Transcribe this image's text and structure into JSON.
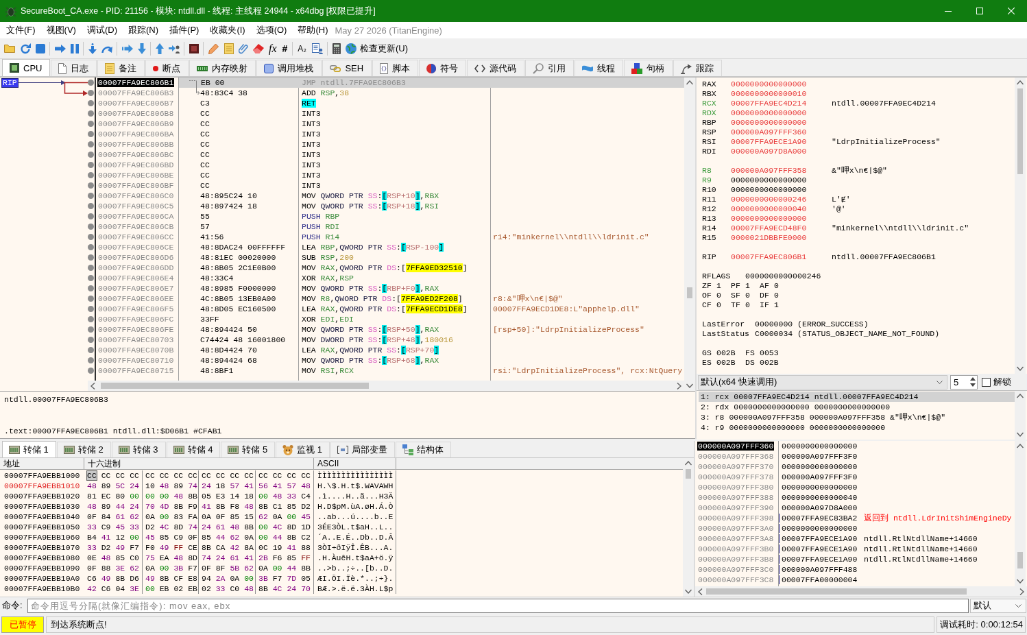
{
  "window": {
    "title": "SecureBoot_CA.exe - PID: 21156 - 模块: ntdll.dll - 线程: 主线程 24944 - x64dbg [权限已提升]"
  },
  "menu": {
    "items": [
      "文件(F)",
      "视图(V)",
      "调试(D)",
      "跟踪(N)",
      "插件(P)",
      "收藏夹(I)",
      "选项(O)",
      "帮助(H)"
    ],
    "build": "May 27 2026 (TitanEngine)"
  },
  "toolbar": {
    "glyphs": [
      "fx",
      "#",
      "A₂"
    ],
    "update_button": "检查更新(U)"
  },
  "tabs": [
    {
      "label": "CPU",
      "selected": true
    },
    {
      "label": "日志",
      "selected": false
    },
    {
      "label": "备注",
      "selected": false
    },
    {
      "label": "断点",
      "selected": false
    },
    {
      "label": "内存映射",
      "selected": false
    },
    {
      "label": "调用堆栈",
      "selected": false
    },
    {
      "label": "SEH",
      "selected": false
    },
    {
      "label": "脚本",
      "selected": false
    },
    {
      "label": "符号",
      "selected": false
    },
    {
      "label": "源代码",
      "selected": false
    },
    {
      "label": "引用",
      "selected": false
    },
    {
      "label": "线程",
      "selected": false
    },
    {
      "label": "句柄",
      "selected": false
    },
    {
      "label": "跟踪",
      "selected": false
    }
  ],
  "disassembly": {
    "rip_label": "RIP",
    "rows": [
      {
        "address": "00007FFA9EC806B1",
        "bytes": "EB 00",
        "kind": "jump_source",
        "selected": true,
        "instruction": [
          {
            "text": "JMP ntdll.7FFA9EC806B3",
            "kind": "dimmed"
          }
        ]
      },
      {
        "address": "00007FFA9EC806B3",
        "bytes": "48:83C4 38",
        "kind": "jump_target",
        "selected": false,
        "instruction": [
          {
            "text": "ADD ",
            "kind": "mnemonic"
          },
          {
            "text": "RSP",
            "kind": "register"
          },
          {
            "text": ",",
            "kind": "plain"
          },
          {
            "text": "38",
            "kind": "number"
          }
        ]
      },
      {
        "address": "00007FFA9EC806B7",
        "bytes": "C3",
        "kind": "code",
        "selected": false,
        "instruction": [
          {
            "text": "RET",
            "kind": "return"
          }
        ]
      },
      {
        "address": "00007FFA9EC806B8",
        "bytes": "CC",
        "kind": "code",
        "selected": false,
        "instruction": [
          {
            "text": "INT3",
            "kind": "mnemonic"
          }
        ]
      },
      {
        "address": "00007FFA9EC806B9",
        "bytes": "CC",
        "kind": "code",
        "selected": false,
        "instruction": [
          {
            "text": "INT3",
            "kind": "mnemonic"
          }
        ]
      },
      {
        "address": "00007FFA9EC806BA",
        "bytes": "CC",
        "kind": "code",
        "selected": false,
        "instruction": [
          {
            "text": "INT3",
            "kind": "mnemonic"
          }
        ]
      },
      {
        "address": "00007FFA9EC806BB",
        "bytes": "CC",
        "kind": "code",
        "selected": false,
        "instruction": [
          {
            "text": "INT3",
            "kind": "mnemonic"
          }
        ]
      },
      {
        "address": "00007FFA9EC806BC",
        "bytes": "CC",
        "kind": "code",
        "selected": false,
        "instruction": [
          {
            "text": "INT3",
            "kind": "mnemonic"
          }
        ]
      },
      {
        "address": "00007FFA9EC806BD",
        "bytes": "CC",
        "kind": "code",
        "selected": false,
        "instruction": [
          {
            "text": "INT3",
            "kind": "mnemonic"
          }
        ]
      },
      {
        "address": "00007FFA9EC806BE",
        "bytes": "CC",
        "kind": "code",
        "selected": false,
        "instruction": [
          {
            "text": "INT3",
            "kind": "mnemonic"
          }
        ]
      },
      {
        "address": "00007FFA9EC806BF",
        "bytes": "CC",
        "kind": "code",
        "selected": false,
        "instruction": [
          {
            "text": "INT3",
            "kind": "mnemonic"
          }
        ]
      },
      {
        "address": "00007FFA9EC806C0",
        "bytes": "48:895C24 10",
        "kind": "code",
        "selected": false,
        "instruction": [
          {
            "text": "MOV ",
            "kind": "mnemonic"
          },
          {
            "text": "QWORD PTR ",
            "kind": "size"
          },
          {
            "text": "SS",
            "kind": "segment"
          },
          {
            "text": ":",
            "kind": "plain"
          },
          {
            "text": "[",
            "kind": "bracket"
          },
          {
            "text": "RSP+10",
            "kind": "memory"
          },
          {
            "text": "]",
            "kind": "bracket"
          },
          {
            "text": ",",
            "kind": "plain"
          },
          {
            "text": "RBX",
            "kind": "register"
          }
        ]
      },
      {
        "address": "00007FFA9EC806C5",
        "bytes": "48:897424 18",
        "kind": "code",
        "selected": false,
        "instruction": [
          {
            "text": "MOV ",
            "kind": "mnemonic"
          },
          {
            "text": "QWORD PTR ",
            "kind": "size"
          },
          {
            "text": "SS",
            "kind": "segment"
          },
          {
            "text": ":",
            "kind": "plain"
          },
          {
            "text": "[",
            "kind": "bracket"
          },
          {
            "text": "RSP+18",
            "kind": "memory"
          },
          {
            "text": "]",
            "kind": "bracket"
          },
          {
            "text": ",",
            "kind": "plain"
          },
          {
            "text": "RSI",
            "kind": "register"
          }
        ]
      },
      {
        "address": "00007FFA9EC806CA",
        "bytes": "55",
        "kind": "code",
        "selected": false,
        "instruction": [
          {
            "text": "PUSH ",
            "kind": "stack_op"
          },
          {
            "text": "RBP",
            "kind": "register"
          }
        ]
      },
      {
        "address": "00007FFA9EC806CB",
        "bytes": "57",
        "kind": "code",
        "selected": false,
        "instruction": [
          {
            "text": "PUSH ",
            "kind": "stack_op"
          },
          {
            "text": "RDI",
            "kind": "register"
          }
        ]
      },
      {
        "address": "00007FFA9EC806CC",
        "bytes": "41:56",
        "kind": "code",
        "selected": false,
        "instruction": [
          {
            "text": "PUSH ",
            "kind": "stack_op"
          },
          {
            "text": "R14",
            "kind": "register"
          }
        ],
        "comment": "r14:\"minkernel\\\\ntdll\\\\ldrinit.c\""
      },
      {
        "address": "00007FFA9EC806CE",
        "bytes": "48:8DAC24 00FFFFFF",
        "kind": "code",
        "selected": false,
        "instruction": [
          {
            "text": "LEA ",
            "kind": "mnemonic"
          },
          {
            "text": "RBP",
            "kind": "register"
          },
          {
            "text": ",",
            "kind": "plain"
          },
          {
            "text": "QWORD PTR ",
            "kind": "size"
          },
          {
            "text": "SS",
            "kind": "segment"
          },
          {
            "text": ":",
            "kind": "plain"
          },
          {
            "text": "[",
            "kind": "bracket"
          },
          {
            "text": "RSP-100",
            "kind": "memory"
          },
          {
            "text": "]",
            "kind": "bracket"
          }
        ]
      },
      {
        "address": "00007FFA9EC806D6",
        "bytes": "48:81EC 00020000",
        "kind": "code",
        "selected": false,
        "instruction": [
          {
            "text": "SUB ",
            "kind": "mnemonic"
          },
          {
            "text": "RSP",
            "kind": "register"
          },
          {
            "text": ",",
            "kind": "plain"
          },
          {
            "text": "200",
            "kind": "number"
          }
        ]
      },
      {
        "address": "00007FFA9EC806DD",
        "bytes": "48:8B05 2C1E0B00",
        "kind": "code",
        "selected": false,
        "instruction": [
          {
            "text": "MOV ",
            "kind": "mnemonic"
          },
          {
            "text": "RAX",
            "kind": "register"
          },
          {
            "text": ",",
            "kind": "plain"
          },
          {
            "text": "QWORD PTR ",
            "kind": "size"
          },
          {
            "text": "DS",
            "kind": "segment"
          },
          {
            "text": ":[",
            "kind": "plain"
          },
          {
            "text": "7FFA9ED32510",
            "kind": "address"
          },
          {
            "text": "]",
            "kind": "plain"
          }
        ]
      },
      {
        "address": "00007FFA9EC806E4",
        "bytes": "48:33C4",
        "kind": "code",
        "selected": false,
        "instruction": [
          {
            "text": "XOR ",
            "kind": "mnemonic"
          },
          {
            "text": "RAX",
            "kind": "register"
          },
          {
            "text": ",",
            "kind": "plain"
          },
          {
            "text": "RSP",
            "kind": "register"
          }
        ]
      },
      {
        "address": "00007FFA9EC806E7",
        "bytes": "48:8985 F0000000",
        "kind": "code",
        "selected": false,
        "instruction": [
          {
            "text": "MOV ",
            "kind": "mnemonic"
          },
          {
            "text": "QWORD PTR ",
            "kind": "size"
          },
          {
            "text": "SS",
            "kind": "segment"
          },
          {
            "text": ":",
            "kind": "plain"
          },
          {
            "text": "[",
            "kind": "bracket"
          },
          {
            "text": "RBP+F0",
            "kind": "memory"
          },
          {
            "text": "]",
            "kind": "bracket"
          },
          {
            "text": ",",
            "kind": "plain"
          },
          {
            "text": "RAX",
            "kind": "register"
          }
        ]
      },
      {
        "address": "00007FFA9EC806EE",
        "bytes": "4C:8B05 13EB0A00",
        "kind": "code",
        "selected": false,
        "instruction": [
          {
            "text": "MOV ",
            "kind": "mnemonic"
          },
          {
            "text": "R8",
            "kind": "register"
          },
          {
            "text": ",",
            "kind": "plain"
          },
          {
            "text": "QWORD PTR ",
            "kind": "size"
          },
          {
            "text": "DS",
            "kind": "segment"
          },
          {
            "text": ":[",
            "kind": "plain"
          },
          {
            "text": "7FFA9ED2F208",
            "kind": "address"
          },
          {
            "text": "]",
            "kind": "plain"
          }
        ],
        "comment": "r8:&\"呷x\\n€|$@\""
      },
      {
        "address": "00007FFA9EC806F5",
        "bytes": "48:8D05 EC160500",
        "kind": "code",
        "selected": false,
        "instruction": [
          {
            "text": "LEA ",
            "kind": "mnemonic"
          },
          {
            "text": "RAX",
            "kind": "register"
          },
          {
            "text": ",",
            "kind": "plain"
          },
          {
            "text": "QWORD PTR ",
            "kind": "size"
          },
          {
            "text": "DS",
            "kind": "segment"
          },
          {
            "text": ":[",
            "kind": "plain"
          },
          {
            "text": "7FFA9ECD1DE8",
            "kind": "address"
          },
          {
            "text": "]",
            "kind": "plain"
          }
        ],
        "comment": "00007FFA9ECD1DE8:L\"apphelp.dll\""
      },
      {
        "address": "00007FFA9EC806FC",
        "bytes": "33FF",
        "kind": "code",
        "selected": false,
        "instruction": [
          {
            "text": "XOR ",
            "kind": "mnemonic"
          },
          {
            "text": "EDI",
            "kind": "register"
          },
          {
            "text": ",",
            "kind": "plain"
          },
          {
            "text": "EDI",
            "kind": "register"
          }
        ]
      },
      {
        "address": "00007FFA9EC806FE",
        "bytes": "48:894424 50",
        "kind": "code",
        "selected": false,
        "instruction": [
          {
            "text": "MOV ",
            "kind": "mnemonic"
          },
          {
            "text": "QWORD PTR ",
            "kind": "size"
          },
          {
            "text": "SS",
            "kind": "segment"
          },
          {
            "text": ":",
            "kind": "plain"
          },
          {
            "text": "[",
            "kind": "bracket"
          },
          {
            "text": "RSP+50",
            "kind": "memory"
          },
          {
            "text": "]",
            "kind": "bracket"
          },
          {
            "text": ",",
            "kind": "plain"
          },
          {
            "text": "RAX",
            "kind": "register"
          }
        ],
        "comment": "[rsp+50]:\"LdrpInitializeProcess\""
      },
      {
        "address": "00007FFA9EC80703",
        "bytes": "C74424 48 16001800",
        "kind": "code",
        "selected": false,
        "instruction": [
          {
            "text": "MOV ",
            "kind": "mnemonic"
          },
          {
            "text": "DWORD PTR ",
            "kind": "size"
          },
          {
            "text": "SS",
            "kind": "segment"
          },
          {
            "text": ":",
            "kind": "plain"
          },
          {
            "text": "[",
            "kind": "bracket"
          },
          {
            "text": "RSP+48",
            "kind": "memory"
          },
          {
            "text": "]",
            "kind": "bracket"
          },
          {
            "text": ",",
            "kind": "plain"
          },
          {
            "text": "180016",
            "kind": "number"
          }
        ]
      },
      {
        "address": "00007FFA9EC8070B",
        "bytes": "48:8D4424 70",
        "kind": "code",
        "selected": false,
        "instruction": [
          {
            "text": "LEA ",
            "kind": "mnemonic"
          },
          {
            "text": "RAX",
            "kind": "register"
          },
          {
            "text": ",",
            "kind": "plain"
          },
          {
            "text": "QWORD PTR ",
            "kind": "size"
          },
          {
            "text": "SS",
            "kind": "segment"
          },
          {
            "text": ":",
            "kind": "plain"
          },
          {
            "text": "[",
            "kind": "bracket"
          },
          {
            "text": "RSP+70",
            "kind": "memory"
          },
          {
            "text": "]",
            "kind": "bracket"
          }
        ]
      },
      {
        "address": "00007FFA9EC80710",
        "bytes": "48:894424 68",
        "kind": "code",
        "selected": false,
        "instruction": [
          {
            "text": "MOV ",
            "kind": "mnemonic"
          },
          {
            "text": "QWORD PTR ",
            "kind": "size"
          },
          {
            "text": "SS",
            "kind": "segment"
          },
          {
            "text": ":",
            "kind": "plain"
          },
          {
            "text": "[",
            "kind": "bracket"
          },
          {
            "text": "RSP+68",
            "kind": "memory"
          },
          {
            "text": "]",
            "kind": "bracket"
          },
          {
            "text": ",",
            "kind": "plain"
          },
          {
            "text": "RAX",
            "kind": "register"
          }
        ]
      },
      {
        "address": "00007FFA9EC80715",
        "bytes": "48:8BF1",
        "kind": "code",
        "selected": false,
        "instruction": [
          {
            "text": "MOV ",
            "kind": "mnemonic"
          },
          {
            "text": "RSI",
            "kind": "register"
          },
          {
            "text": ",",
            "kind": "plain"
          },
          {
            "text": "RCX",
            "kind": "register"
          }
        ],
        "comment": "rsi:\"LdrpInitializeProcess\", rcx:NtQuery"
      }
    ]
  },
  "info": {
    "lines": [
      "ntdll.00007FFA9EC806B3",
      ".text:00007FFA9EC806B1 ntdll.dll:$D06B1 #CFAB1"
    ]
  },
  "registers": {
    "general": [
      {
        "name": "RAX",
        "value": "0000000000000000",
        "changed": true,
        "argument": false
      },
      {
        "name": "RBX",
        "value": "0000000000000010",
        "changed": true,
        "argument": false
      },
      {
        "name": "RCX",
        "value": "00007FFA9EC4D214",
        "changed": true,
        "argument": true,
        "info": "ntdll.00007FFA9EC4D214"
      },
      {
        "name": "RDX",
        "value": "0000000000000000",
        "changed": true,
        "argument": true
      },
      {
        "name": "RBP",
        "value": "0000000000000000",
        "changed": true,
        "argument": false
      },
      {
        "name": "RSP",
        "value": "000000A097FFF360",
        "changed": true,
        "argument": false
      },
      {
        "name": "RSI",
        "value": "00007FFA9ECE1A90",
        "changed": true,
        "argument": false,
        "info": "\"LdrpInitializeProcess\""
      },
      {
        "name": "RDI",
        "value": "000000A097D8A000",
        "changed": true,
        "argument": false
      }
    ],
    "extended": [
      {
        "name": "R8",
        "value": "000000A097FFF358",
        "changed": true,
        "argument": true,
        "info": "&\"呷x\\n€|$@\""
      },
      {
        "name": "R9",
        "value": "0000000000000000",
        "changed": false,
        "argument": true
      },
      {
        "name": "R10",
        "value": "0000000000000000",
        "changed": false,
        "argument": false
      },
      {
        "name": "R11",
        "value": "0000000000000246",
        "changed": true,
        "argument": false,
        "info": "L'Ɇ'"
      },
      {
        "name": "R12",
        "value": "0000000000000040",
        "changed": true,
        "argument": false,
        "info": "'@'"
      },
      {
        "name": "R13",
        "value": "0000000000000000",
        "changed": true,
        "argument": false
      },
      {
        "name": "R14",
        "value": "00007FFA9ECD48F0",
        "changed": true,
        "argument": false,
        "info": "\"minkernel\\\\ntdll\\\\ldrinit.c\""
      },
      {
        "name": "R15",
        "value": "0000021DBBFE0000",
        "changed": true,
        "argument": false
      }
    ],
    "instruction_pointer": [
      {
        "name": "RIP",
        "value": "00007FFA9EC806B1",
        "changed": true,
        "argument": false,
        "info": "ntdll.00007FFA9EC806B1"
      }
    ],
    "rflags": {
      "name": "RFLAGS",
      "value": "0000000000000246"
    },
    "flags": [
      [
        {
          "name": "ZF",
          "value": "1"
        },
        {
          "name": "PF",
          "value": "1"
        },
        {
          "name": "AF",
          "value": "0"
        }
      ],
      [
        {
          "name": "OF",
          "value": "0"
        },
        {
          "name": "SF",
          "value": "0"
        },
        {
          "name": "DF",
          "value": "0"
        }
      ],
      [
        {
          "name": "CF",
          "value": "0"
        },
        {
          "name": "TF",
          "value": "0"
        },
        {
          "name": "IF",
          "value": "1"
        }
      ]
    ],
    "errors": [
      {
        "name": "LastError",
        "value": "00000000 (ERROR_SUCCESS)"
      },
      {
        "name": "LastStatus",
        "value": "C0000034 (STATUS_OBJECT_NAME_NOT_FOUND)"
      }
    ],
    "segments": [
      [
        {
          "name": "GS",
          "value": "002B"
        },
        {
          "name": "FS",
          "value": "0053"
        }
      ],
      [
        {
          "name": "ES",
          "value": "002B"
        },
        {
          "name": "DS",
          "value": "002B"
        }
      ]
    ]
  },
  "calling_convention": {
    "convention": "默认(x64 快速调用)",
    "arg_count": "5",
    "unlock": {
      "label": "解锁",
      "checked": false
    }
  },
  "arguments": [
    {
      "text": "1: rcx 00007FFA9EC4D214 ntdll.00007FFA9EC4D214",
      "selected": true
    },
    {
      "text": "2: rdx 0000000000000000 0000000000000000",
      "selected": false
    },
    {
      "text": "3: r8 000000A097FFF358 000000A097FFF358 &\"呷x\\n€|$@\"",
      "selected": false
    },
    {
      "text": "4: r9 0000000000000000 0000000000000000",
      "selected": false
    }
  ],
  "dump_tabs": [
    {
      "label": "转储 1",
      "selected": true
    },
    {
      "label": "转储 2",
      "selected": false
    },
    {
      "label": "转储 3",
      "selected": false
    },
    {
      "label": "转储 4",
      "selected": false
    },
    {
      "label": "转储 5",
      "selected": false
    },
    {
      "label": "监视 1",
      "selected": false
    },
    {
      "label": "局部变量",
      "selected": false
    },
    {
      "label": "结构体",
      "selected": false
    }
  ],
  "dump": {
    "columns": [
      "地址",
      "十六进制",
      "ASCII"
    ],
    "rows": [
      {
        "address": "00007FFA9EBB1000",
        "hex": [
          "CC CC CC CC",
          "CC CC CC CC",
          "CC CC CC CC",
          "CC CC CC CC"
        ],
        "ascii": "ÌÌÌÌÌÌÌÌÌÌÌÌÌÌÌÌ",
        "selected": true,
        "highlighted": false
      },
      {
        "address": "00007FFA9EBB1010",
        "hex": [
          "48 89 5C 24",
          "10 48 89 74",
          "24 18 57 41",
          "56 41 57 48"
        ],
        "ascii": "H.\\$.H.t$.WAVAWH",
        "selected": false,
        "highlighted": true
      },
      {
        "address": "00007FFA9EBB1020",
        "hex": [
          "81 EC 80 00",
          "00 00 48 8B",
          "05 E3 14 18",
          "00 48 33 C4"
        ],
        "ascii": ".ì....H..ã...H3Ä",
        "selected": false,
        "highlighted": false
      },
      {
        "address": "00007FFA9EBB1030",
        "hex": [
          "48 89 44 24",
          "70 4D 8B F9",
          "41 8B F8 48",
          "8B C1 85 D2"
        ],
        "ascii": "H.D$pM.ùA.øH.Á.Ò",
        "selected": false,
        "highlighted": false
      },
      {
        "address": "00007FFA9EBB1040",
        "hex": [
          "0F 84 61 62",
          "0A 00 83 FA",
          "0A 0F 85 15",
          "62 0A 00 45"
        ],
        "ascii": "..ab...ú....b..E",
        "selected": false,
        "highlighted": false
      },
      {
        "address": "00007FFA9EBB1050",
        "hex": [
          "33 C9 45 33",
          "D2 4C 8D 74",
          "24 61 48 8B",
          "00 4C 8D 1D"
        ],
        "ascii": "3ÉE3ÒL.t$aH..L..",
        "selected": false,
        "highlighted": false
      },
      {
        "address": "00007FFA9EBB1060",
        "hex": [
          "B4 41 12 00",
          "45 85 C9 0F",
          "85 44 62 0A",
          "00 44 8B C2"
        ],
        "ascii": "´A..E.É..Db..D.Â",
        "selected": false,
        "highlighted": false
      },
      {
        "address": "00007FFA9EBB1070",
        "hex": [
          "33 D2 49 F7",
          "F0 49 FF CE",
          "8B CA 42 8A",
          "0C 19 41 88"
        ],
        "ascii": "3ÒI÷ðIÿÎ.ÊB...A.",
        "selected": false,
        "highlighted": false
      },
      {
        "address": "00007FFA9EBB1080",
        "hex": [
          "0E 48 85 C0",
          "75 EA 48 8D",
          "74 24 61 41",
          "2B F6 85 FF"
        ],
        "ascii": ".H.ÀuêH.t$aA+ö.ÿ",
        "selected": false,
        "highlighted": false
      },
      {
        "address": "00007FFA9EBB1090",
        "hex": [
          "0F 88 3E 62",
          "0A 00 3B F7",
          "0F 8F 5B 62",
          "0A 00 44 8B"
        ],
        "ascii": "..>b..;÷..[b..D.",
        "selected": false,
        "highlighted": false
      },
      {
        "address": "00007FFA9EBB10A0",
        "hex": [
          "C6 49 8B D6",
          "49 8B CF E8",
          "94 2A 0A 00",
          "3B F7 7D 05"
        ],
        "ascii": "ÆI.ÖI.Ïè.*..;÷}.",
        "selected": false,
        "highlighted": false
      },
      {
        "address": "00007FFA9EBB10B0",
        "hex": [
          "42 C6 04 3E",
          "00 EB 02 EB",
          "02 33 C0 48",
          "8B 4C 24 70"
        ],
        "ascii": "BÆ.>.ë.ë.3ÀH.L$p",
        "selected": false,
        "highlighted": false
      }
    ]
  },
  "stack": {
    "rows": [
      {
        "address": "000000A097FFF360",
        "value": "0000000000000000",
        "selected": true,
        "frame": false
      },
      {
        "address": "000000A097FFF368",
        "value": "000000A097FFF3F0",
        "selected": false,
        "frame": false
      },
      {
        "address": "000000A097FFF370",
        "value": "0000000000000000",
        "selected": false,
        "frame": false
      },
      {
        "address": "000000A097FFF378",
        "value": "000000A097FFF3F0",
        "selected": false,
        "frame": false
      },
      {
        "address": "000000A097FFF380",
        "value": "0000000000000000",
        "selected": false,
        "frame": false
      },
      {
        "address": "000000A097FFF388",
        "value": "0000000000000040",
        "selected": false,
        "frame": false
      },
      {
        "address": "000000A097FFF390",
        "value": "000000A097D8A000",
        "selected": false,
        "frame": false
      },
      {
        "address": "000000A097FFF398",
        "value": "00007FFA9EC83BA2",
        "comment": "返回到 ntdll.LdrInitShimEngineDy",
        "selected": false,
        "frame": true,
        "returns": true
      },
      {
        "address": "000000A097FFF3A0",
        "value": "0000000000000000",
        "selected": false,
        "frame": true
      },
      {
        "address": "000000A097FFF3A8",
        "value": "00007FFA9ECE1A90",
        "comment": "ntdll.RtlNtdllName+14660",
        "selected": false,
        "frame": true,
        "returns": false
      },
      {
        "address": "000000A097FFF3B0",
        "value": "00007FFA9ECE1A90",
        "comment": "ntdll.RtlNtdllName+14660",
        "selected": false,
        "frame": true,
        "returns": false
      },
      {
        "address": "000000A097FFF3B8",
        "value": "00007FFA9ECE1A90",
        "comment": "ntdll.RtlNtdllName+14660",
        "selected": false,
        "frame": true,
        "returns": false
      },
      {
        "address": "000000A097FFF3C0",
        "value": "000000A097FFF488",
        "selected": false,
        "frame": true
      },
      {
        "address": "000000A097FFF3C8",
        "value": "00007FFA00000004",
        "selected": false,
        "frame": true
      }
    ]
  },
  "command": {
    "label": "命令:",
    "placeholder": "命令用逗号分隔(就像汇编指令): mov eax, ebx",
    "mode": "默认"
  },
  "status": {
    "state": "已暂停",
    "message": "到达系统断点!",
    "elapsed": "调试耗时: 0:00:12:54"
  }
}
